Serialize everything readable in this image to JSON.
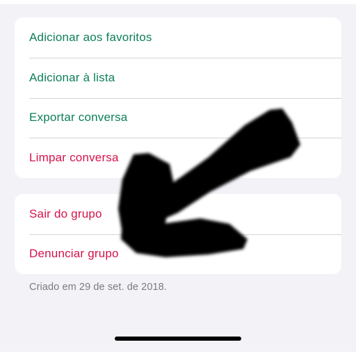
{
  "menu_group_1": {
    "items": [
      {
        "label": "Adicionar aos favoritos",
        "color": "#0d7f5a"
      },
      {
        "label": "Adicionar à lista",
        "color": "#0d7f5a"
      },
      {
        "label": "Exportar conversa",
        "color": "#0d7f5a"
      },
      {
        "label": "Limpar conversa",
        "color": "#d6124a"
      }
    ]
  },
  "menu_group_2": {
    "items": [
      {
        "label": "Sair do grupo",
        "color": "#d6124a"
      },
      {
        "label": "Denunciar grupo",
        "color": "#d6124a"
      }
    ]
  },
  "footer": {
    "created_text": "Criado em 29 de set. de 2018."
  },
  "annotation": {
    "icon": "hand-drawn-arrow-icon",
    "color": "#000000"
  }
}
